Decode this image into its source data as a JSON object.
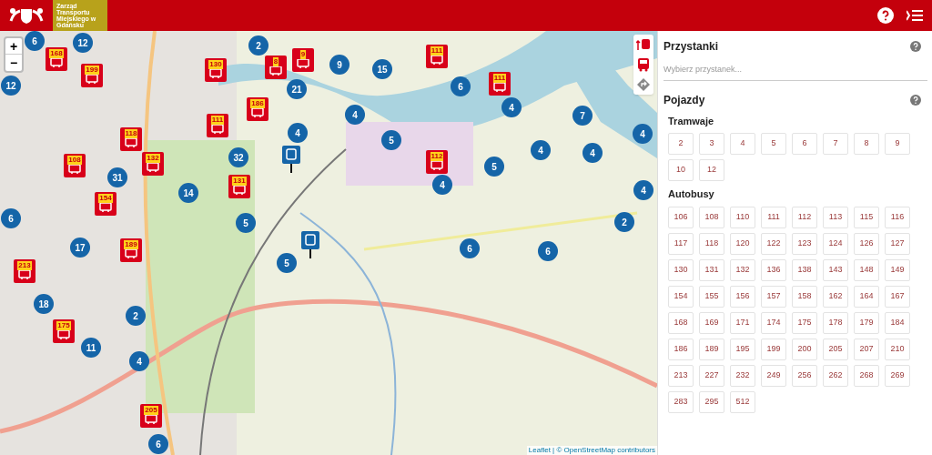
{
  "header": {
    "logo_text": "Zarząd Transportu Miejskiego w Gdańsku"
  },
  "map": {
    "zoom_in": "+",
    "zoom_out": "−",
    "attribution": "Leaflet | © OpenStreetMap contributors",
    "clusters": [
      "6",
      "12",
      "2",
      "9",
      "15",
      "12",
      "21",
      "6",
      "4",
      "4",
      "7",
      "4",
      "5",
      "4",
      "32",
      "4",
      "4",
      "31",
      "5",
      "14",
      "4",
      "4",
      "6",
      "5",
      "2",
      "17",
      "6",
      "6",
      "5",
      "18",
      "2",
      "11",
      "4",
      "6"
    ],
    "vehicles": [
      "168",
      "9",
      "111",
      "199",
      "130",
      "8",
      "111",
      "186",
      "111",
      "118",
      "108",
      "132",
      "112",
      "131",
      "154",
      "189",
      "213",
      "175",
      "205"
    ]
  },
  "panel": {
    "stops": {
      "title": "Przystanki",
      "placeholder": "Wybierz przystanek..."
    },
    "vehicles": {
      "title": "Pojazdy",
      "groups": [
        {
          "title": "Tramwaje",
          "lines": [
            "2",
            "3",
            "4",
            "5",
            "6",
            "7",
            "8",
            "9",
            "10",
            "12"
          ]
        },
        {
          "title": "Autobusy",
          "lines": [
            "106",
            "108",
            "110",
            "111",
            "112",
            "113",
            "115",
            "116",
            "117",
            "118",
            "120",
            "122",
            "123",
            "124",
            "126",
            "127",
            "130",
            "131",
            "132",
            "136",
            "138",
            "143",
            "148",
            "149",
            "154",
            "155",
            "156",
            "157",
            "158",
            "162",
            "164",
            "167",
            "168",
            "169",
            "171",
            "174",
            "175",
            "178",
            "179",
            "184",
            "186",
            "189",
            "195",
            "199",
            "200",
            "205",
            "207",
            "210",
            "213",
            "227",
            "232",
            "249",
            "256",
            "262",
            "268",
            "269",
            "283",
            "295",
            "512"
          ]
        }
      ]
    }
  }
}
